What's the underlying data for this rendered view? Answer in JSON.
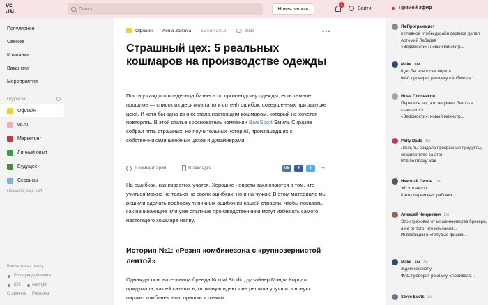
{
  "header": {
    "logo_line1": "vc",
    "logo_line2": ".ru",
    "search_placeholder": "Поиск",
    "new_post": "Новая запись",
    "notif_count": "1",
    "login": "Войти",
    "live": "Прямой эфир"
  },
  "sidebar": {
    "nav": [
      "Популярное",
      "Свежее",
      "Компании",
      "Вакансии",
      "Мероприятия"
    ],
    "subs_label": "Подписки",
    "subs": [
      {
        "label": "Офлайн",
        "color": "#f2d226",
        "active": true
      },
      {
        "label": "vc.ru",
        "color": "#e8b1b1",
        "active": false
      },
      {
        "label": "Маркетинг",
        "color": "#c43c3c",
        "active": false
      },
      {
        "label": "Личный опыт",
        "color": "#3c9a4a",
        "active": false
      },
      {
        "label": "Будущее",
        "color": "#4a8a3a",
        "active": false
      },
      {
        "label": "Сервисы",
        "color": "#7fb0d6",
        "active": false
      }
    ],
    "show_more": "Показать еще 124",
    "footer": [
      "Рассылка на почту",
      "Push-уведомления",
      "iOS",
      "Android",
      "О проекте",
      "Реклама"
    ]
  },
  "article": {
    "category": "Офлайн",
    "author": "Xenia Zaikova",
    "date": "15 ноя 2019",
    "views": "1918",
    "title": "Страшный цех: 5 реальных кошмаров на производстве одежды",
    "lead_1": "Почти у каждого владельца бизнеса по производству одежды, есть темное прошлое — список из десятков (а то и сотен!) ошибок, совершенных при запуске цеха. И хотя бы одна из них стала настоящим кошмаром, который не хочется повторять. В этой статье сооснователь компании ",
    "lead_link": "BarsSport",
    "lead_2": " Эмиль Сиразев собрал пять страшных, но поучительных историй, произошедших с собственниками швейных цехов и дизайнерами.",
    "comments": "1 комментарий",
    "bookmarks": "В закладки",
    "share": [
      "VK",
      "f",
      "t"
    ],
    "share_colors": [
      "#4c75a3",
      "#3b5998",
      "#55acee"
    ],
    "body": "На ошибках, как известно, учатся. Хорошие новости заключаются в том, что учиться можно не только на своих ошибках, но и на чужих. В этом материале мы решили сделать подборку типичных ошибок из нашей отрасли, чтобы показать, как начинающие или уже опытные производственники могут избежать самого настоящего кошмара наяву.",
    "h2": "История №1: «Резня комбинезона с крупнозернистой лентой»",
    "body2": "Однажды основательница бренда Kordal Studio, дизайнер Мэнди Кордал придумала, как ей казалось, отличную идею: она решила улучшить новую партию комбинезонов, пришив к тонким"
  },
  "feed": [
    {
      "author": "ЯжПрограммист",
      "time": "",
      "text": "и главное чтобы дизайн сервиса делал Артемий Лебедев",
      "source": "«Ведомости»: новый министр...",
      "color": "#888"
    },
    {
      "author": "Make Luv",
      "time": "",
      "text": "Щас бы новостям верить.",
      "source": "ФАС проверит рекламу «Арбидола...",
      "color": "#2c4a7a"
    },
    {
      "author": "Илья Плотников",
      "time": "",
      "text": "Перепись тех, кто не умеет без тэга <sarcasm/>",
      "source": "«Ведомости»: новый министр...",
      "color": "#b0a090"
    },
    {
      "author": "Polly Dada",
      "time": "1м",
      "text": "Лена, ты создала прекрасные продукты, спасибо тебе за это)",
      "source": "Всё по плану: как...",
      "color": "#c0395a"
    },
    {
      "author": "Николай Сизов",
      "time": "1м",
      "text": "эй, это автор",
      "source": "Каких сервисных рабочих...",
      "color": "#555"
    },
    {
      "author": "Алексей Чечукевич",
      "time": "2м",
      "text": "Это страховка от мошенничества брокера, а не от того, что компания...",
      "source": "Инвестиции в «голубые фишки...",
      "color": "#8a6a5a"
    },
    {
      "author": "Make Luv",
      "time": "2м",
      "text": "Ждем кокаколу.",
      "source": "ФАС проверит рекламу «Арбидола...",
      "color": "#2c4a7a"
    },
    {
      "author": "Steve Evets",
      "time": "2м",
      "text": "",
      "source": "",
      "color": "#6a7a8a"
    }
  ]
}
